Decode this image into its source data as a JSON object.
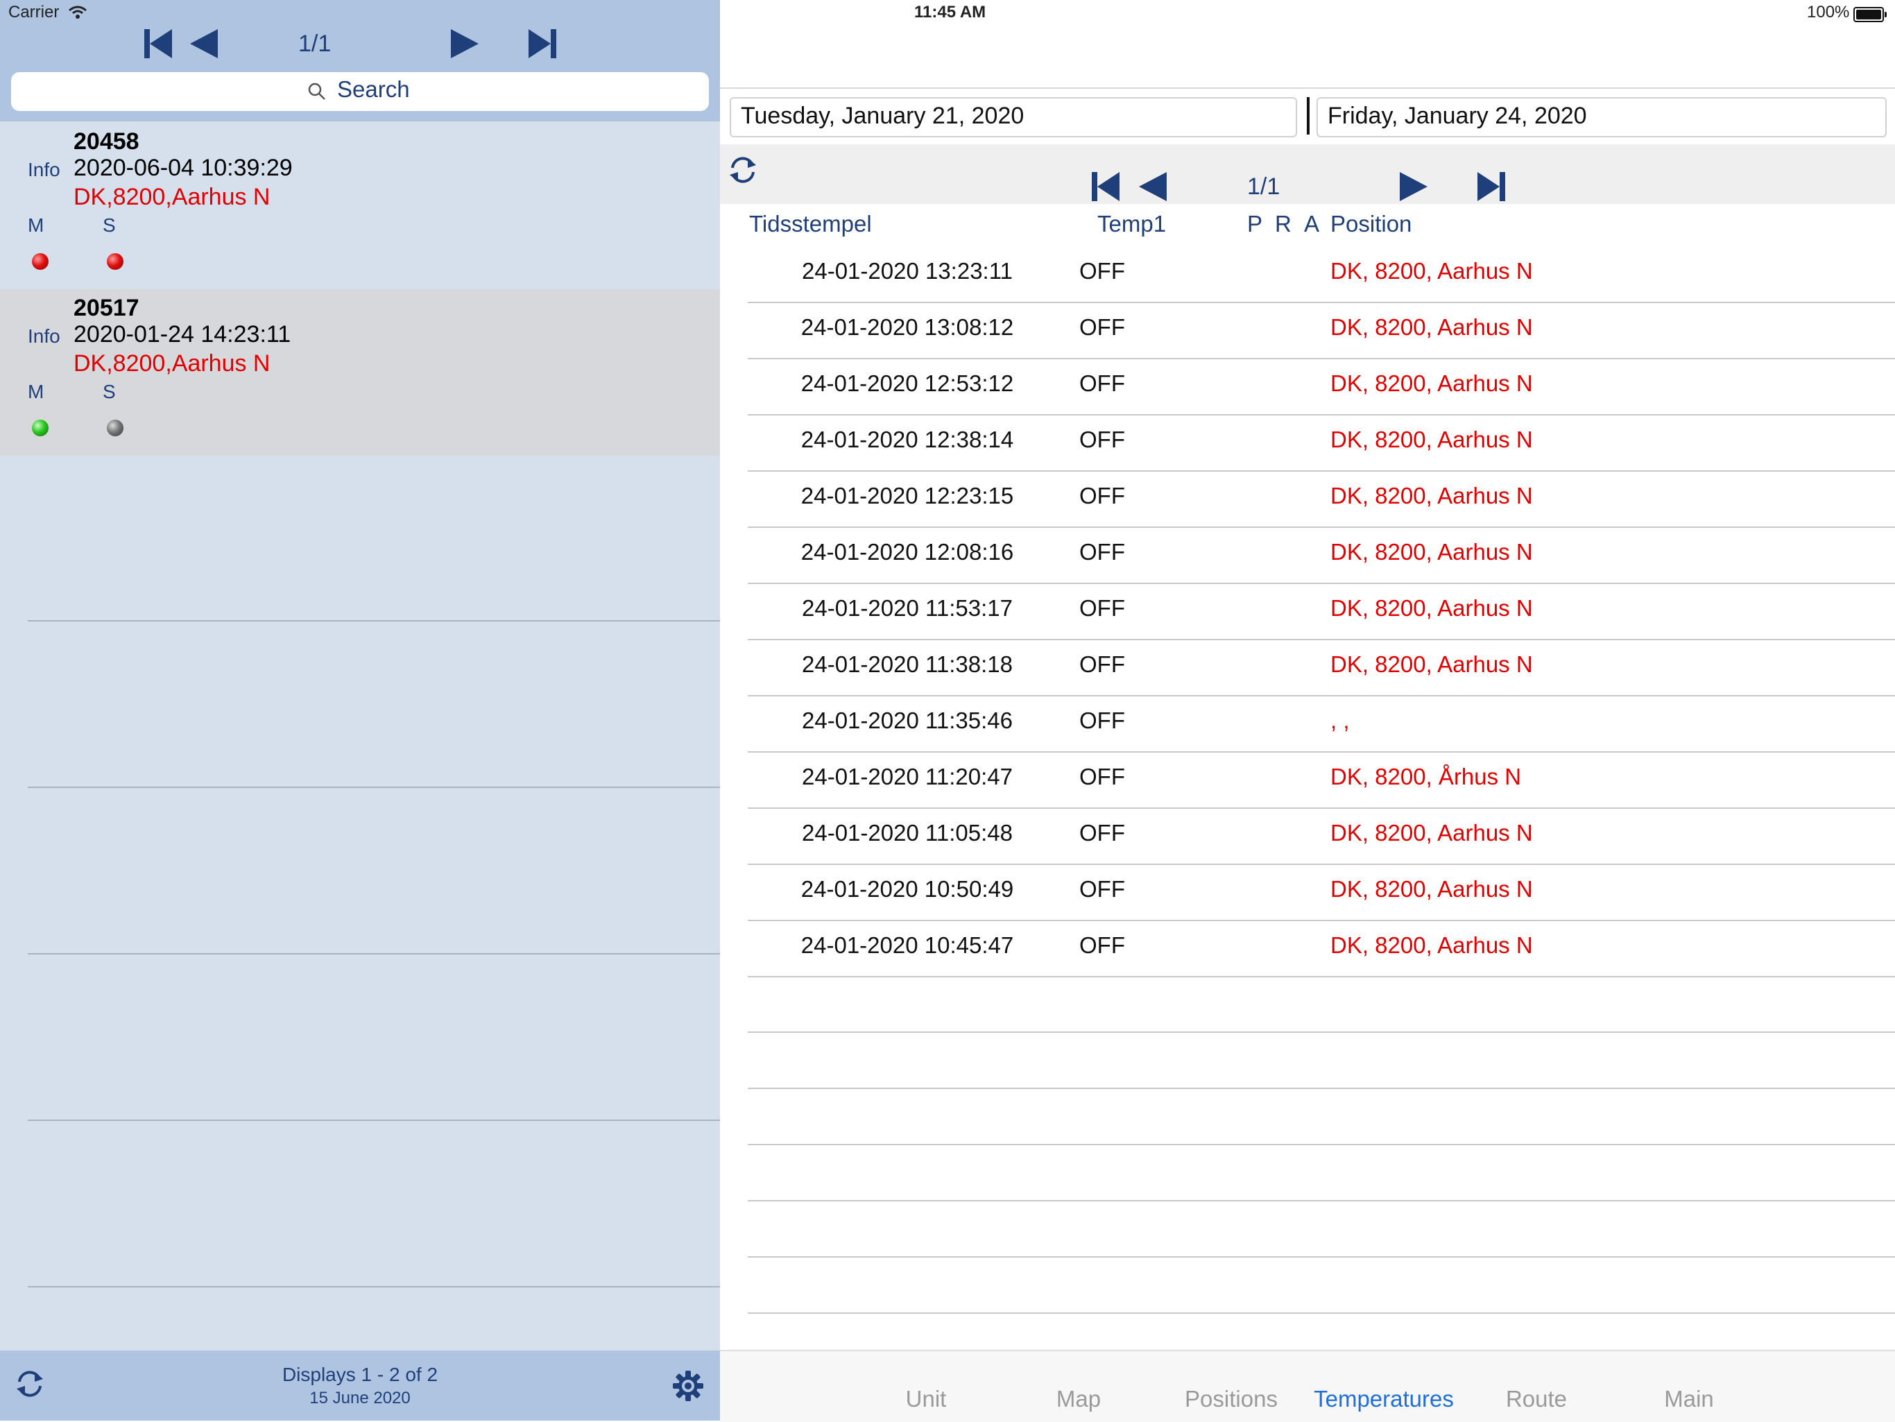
{
  "status_bar": {
    "carrier": "Carrier",
    "time": "11:45 AM",
    "battery": "100%"
  },
  "left": {
    "pager": {
      "page": "1/1"
    },
    "search": {
      "label": "Search"
    },
    "devices": [
      {
        "id": "20458",
        "info": "Info",
        "timestamp": "2020-06-04 10:39:29",
        "location": "DK,8200,Aarhus N",
        "m_label": "M",
        "s_label": "S",
        "m_status": "red",
        "s_status": "red"
      },
      {
        "id": "20517",
        "info": "Info",
        "timestamp": "2020-01-24 14:23:11",
        "location": "DK,8200,Aarhus N",
        "m_label": "M",
        "s_label": "S",
        "m_status": "green",
        "s_status": "gray"
      }
    ],
    "footer": {
      "count": "Displays 1 - 2 of 2",
      "date": "15 June 2020"
    }
  },
  "right": {
    "from_date": "Tuesday, January 21, 2020",
    "to_date": "Friday, January 24, 2020",
    "pager": {
      "page": "1/1"
    },
    "columns": {
      "timestamp": "Tidsstempel",
      "temp1": "Temp1",
      "p": "P",
      "r": "R",
      "a": "A",
      "position": "Position"
    },
    "rows": [
      {
        "timestamp": "24-01-2020 13:23:11",
        "temp1": "OFF",
        "position": "DK, 8200, Aarhus N"
      },
      {
        "timestamp": "24-01-2020 13:08:12",
        "temp1": "OFF",
        "position": "DK, 8200, Aarhus N"
      },
      {
        "timestamp": "24-01-2020 12:53:12",
        "temp1": "OFF",
        "position": "DK, 8200, Aarhus N"
      },
      {
        "timestamp": "24-01-2020 12:38:14",
        "temp1": "OFF",
        "position": "DK, 8200, Aarhus N"
      },
      {
        "timestamp": "24-01-2020 12:23:15",
        "temp1": "OFF",
        "position": "DK, 8200, Aarhus N"
      },
      {
        "timestamp": "24-01-2020 12:08:16",
        "temp1": "OFF",
        "position": "DK, 8200, Aarhus N"
      },
      {
        "timestamp": "24-01-2020 11:53:17",
        "temp1": "OFF",
        "position": "DK, 8200, Aarhus N"
      },
      {
        "timestamp": "24-01-2020 11:38:18",
        "temp1": "OFF",
        "position": "DK, 8200, Aarhus N"
      },
      {
        "timestamp": "24-01-2020 11:35:46",
        "temp1": "OFF",
        "position": ", ,"
      },
      {
        "timestamp": "24-01-2020 11:20:47",
        "temp1": "OFF",
        "position": "DK, 8200, Århus N"
      },
      {
        "timestamp": "24-01-2020 11:05:48",
        "temp1": "OFF",
        "position": "DK, 8200, Aarhus N"
      },
      {
        "timestamp": "24-01-2020 10:50:49",
        "temp1": "OFF",
        "position": "DK, 8200, Aarhus N"
      },
      {
        "timestamp": "24-01-2020 10:45:47",
        "temp1": "OFF",
        "position": "DK, 8200, Aarhus N"
      }
    ],
    "tabs": [
      {
        "label": "Unit"
      },
      {
        "label": "Map"
      },
      {
        "label": "Positions"
      },
      {
        "label": "Temperatures"
      },
      {
        "label": "Route"
      },
      {
        "label": "Main"
      }
    ],
    "active_tab": "Temperatures"
  },
  "icons": {
    "first": "first-page-icon",
    "prev": "previous-page-icon",
    "next": "next-page-icon",
    "last": "last-page-icon",
    "search": "search-icon",
    "refresh": "refresh-icon",
    "settings": "gear-icon"
  },
  "colors": {
    "accent": "#1f3f7a",
    "alert": "#e00000",
    "tab_active": "#1e6fd9",
    "header_bg": "#aec4e0",
    "panel_bg": "#d6e0ec"
  }
}
